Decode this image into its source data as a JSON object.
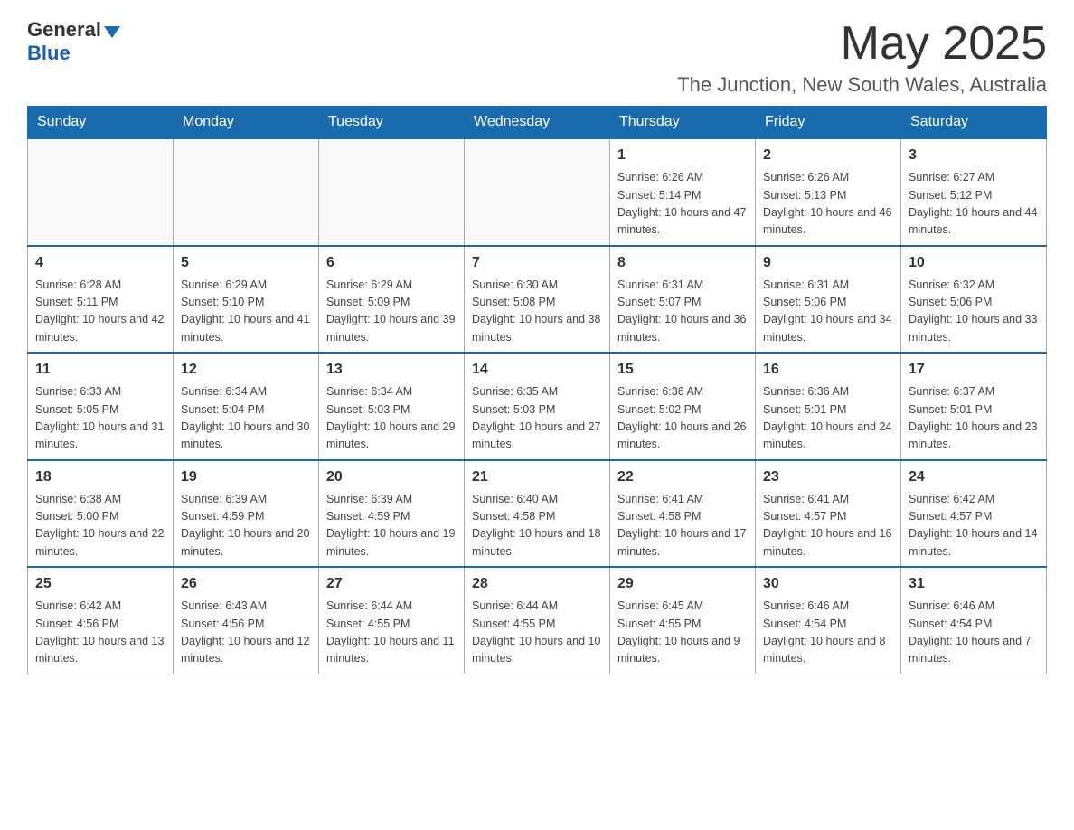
{
  "header": {
    "logo_general": "General",
    "logo_blue": "Blue",
    "month_year": "May 2025",
    "location": "The Junction, New South Wales, Australia"
  },
  "days_of_week": [
    "Sunday",
    "Monday",
    "Tuesday",
    "Wednesday",
    "Thursday",
    "Friday",
    "Saturday"
  ],
  "weeks": [
    [
      {
        "day": "",
        "info": ""
      },
      {
        "day": "",
        "info": ""
      },
      {
        "day": "",
        "info": ""
      },
      {
        "day": "",
        "info": ""
      },
      {
        "day": "1",
        "info": "Sunrise: 6:26 AM\nSunset: 5:14 PM\nDaylight: 10 hours and 47 minutes."
      },
      {
        "day": "2",
        "info": "Sunrise: 6:26 AM\nSunset: 5:13 PM\nDaylight: 10 hours and 46 minutes."
      },
      {
        "day": "3",
        "info": "Sunrise: 6:27 AM\nSunset: 5:12 PM\nDaylight: 10 hours and 44 minutes."
      }
    ],
    [
      {
        "day": "4",
        "info": "Sunrise: 6:28 AM\nSunset: 5:11 PM\nDaylight: 10 hours and 42 minutes."
      },
      {
        "day": "5",
        "info": "Sunrise: 6:29 AM\nSunset: 5:10 PM\nDaylight: 10 hours and 41 minutes."
      },
      {
        "day": "6",
        "info": "Sunrise: 6:29 AM\nSunset: 5:09 PM\nDaylight: 10 hours and 39 minutes."
      },
      {
        "day": "7",
        "info": "Sunrise: 6:30 AM\nSunset: 5:08 PM\nDaylight: 10 hours and 38 minutes."
      },
      {
        "day": "8",
        "info": "Sunrise: 6:31 AM\nSunset: 5:07 PM\nDaylight: 10 hours and 36 minutes."
      },
      {
        "day": "9",
        "info": "Sunrise: 6:31 AM\nSunset: 5:06 PM\nDaylight: 10 hours and 34 minutes."
      },
      {
        "day": "10",
        "info": "Sunrise: 6:32 AM\nSunset: 5:06 PM\nDaylight: 10 hours and 33 minutes."
      }
    ],
    [
      {
        "day": "11",
        "info": "Sunrise: 6:33 AM\nSunset: 5:05 PM\nDaylight: 10 hours and 31 minutes."
      },
      {
        "day": "12",
        "info": "Sunrise: 6:34 AM\nSunset: 5:04 PM\nDaylight: 10 hours and 30 minutes."
      },
      {
        "day": "13",
        "info": "Sunrise: 6:34 AM\nSunset: 5:03 PM\nDaylight: 10 hours and 29 minutes."
      },
      {
        "day": "14",
        "info": "Sunrise: 6:35 AM\nSunset: 5:03 PM\nDaylight: 10 hours and 27 minutes."
      },
      {
        "day": "15",
        "info": "Sunrise: 6:36 AM\nSunset: 5:02 PM\nDaylight: 10 hours and 26 minutes."
      },
      {
        "day": "16",
        "info": "Sunrise: 6:36 AM\nSunset: 5:01 PM\nDaylight: 10 hours and 24 minutes."
      },
      {
        "day": "17",
        "info": "Sunrise: 6:37 AM\nSunset: 5:01 PM\nDaylight: 10 hours and 23 minutes."
      }
    ],
    [
      {
        "day": "18",
        "info": "Sunrise: 6:38 AM\nSunset: 5:00 PM\nDaylight: 10 hours and 22 minutes."
      },
      {
        "day": "19",
        "info": "Sunrise: 6:39 AM\nSunset: 4:59 PM\nDaylight: 10 hours and 20 minutes."
      },
      {
        "day": "20",
        "info": "Sunrise: 6:39 AM\nSunset: 4:59 PM\nDaylight: 10 hours and 19 minutes."
      },
      {
        "day": "21",
        "info": "Sunrise: 6:40 AM\nSunset: 4:58 PM\nDaylight: 10 hours and 18 minutes."
      },
      {
        "day": "22",
        "info": "Sunrise: 6:41 AM\nSunset: 4:58 PM\nDaylight: 10 hours and 17 minutes."
      },
      {
        "day": "23",
        "info": "Sunrise: 6:41 AM\nSunset: 4:57 PM\nDaylight: 10 hours and 16 minutes."
      },
      {
        "day": "24",
        "info": "Sunrise: 6:42 AM\nSunset: 4:57 PM\nDaylight: 10 hours and 14 minutes."
      }
    ],
    [
      {
        "day": "25",
        "info": "Sunrise: 6:42 AM\nSunset: 4:56 PM\nDaylight: 10 hours and 13 minutes."
      },
      {
        "day": "26",
        "info": "Sunrise: 6:43 AM\nSunset: 4:56 PM\nDaylight: 10 hours and 12 minutes."
      },
      {
        "day": "27",
        "info": "Sunrise: 6:44 AM\nSunset: 4:55 PM\nDaylight: 10 hours and 11 minutes."
      },
      {
        "day": "28",
        "info": "Sunrise: 6:44 AM\nSunset: 4:55 PM\nDaylight: 10 hours and 10 minutes."
      },
      {
        "day": "29",
        "info": "Sunrise: 6:45 AM\nSunset: 4:55 PM\nDaylight: 10 hours and 9 minutes."
      },
      {
        "day": "30",
        "info": "Sunrise: 6:46 AM\nSunset: 4:54 PM\nDaylight: 10 hours and 8 minutes."
      },
      {
        "day": "31",
        "info": "Sunrise: 6:46 AM\nSunset: 4:54 PM\nDaylight: 10 hours and 7 minutes."
      }
    ]
  ]
}
